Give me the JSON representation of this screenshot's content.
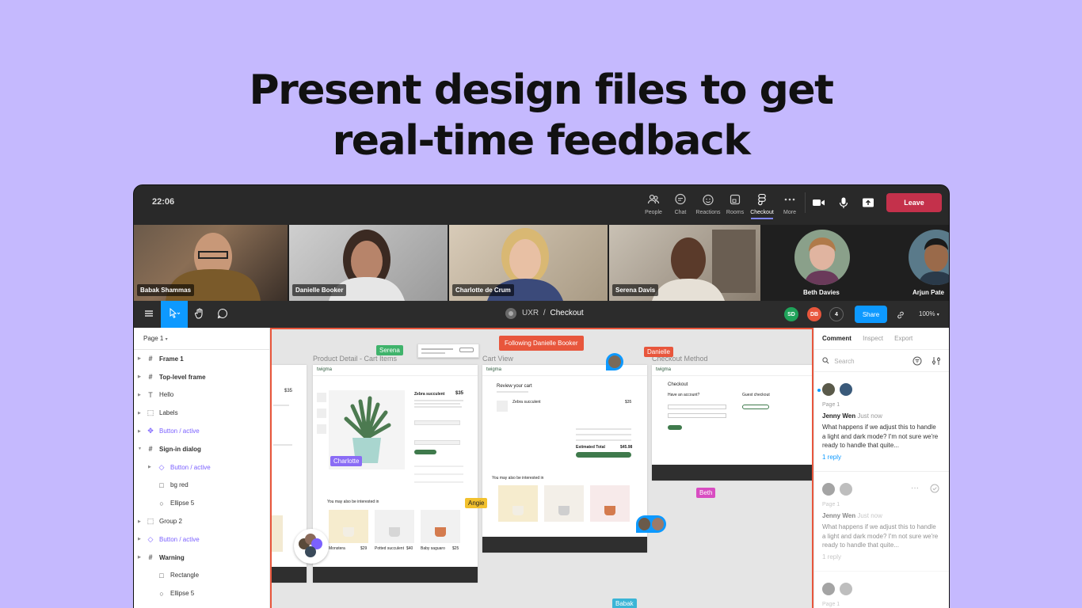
{
  "headline": {
    "line1": "Present design files to get",
    "line2": "real-time feedback"
  },
  "meeting": {
    "time": "22:06",
    "tools": [
      {
        "label": "People",
        "icon": "people-icon"
      },
      {
        "label": "Chat",
        "icon": "chat-icon"
      },
      {
        "label": "Reactions",
        "icon": "reactions-icon"
      },
      {
        "label": "Rooms",
        "icon": "rooms-icon"
      },
      {
        "label": "Checkout",
        "icon": "figma-icon"
      },
      {
        "label": "More",
        "icon": "more-icon"
      }
    ],
    "leave_label": "Leave",
    "participants": [
      "Babak Shammas",
      "Danielle Booker",
      "Charlotte de Crum",
      "Serena Davis"
    ],
    "avatars": [
      "Beth Davies",
      "Arjun Pate"
    ]
  },
  "figma": {
    "project": "UXR",
    "separator": "/",
    "file": "Checkout",
    "collaborators": [
      {
        "initials": "SD",
        "color": "#1fa35a"
      },
      {
        "initials": "DB",
        "color": "#e8563c"
      }
    ],
    "collab_count": "4",
    "share_label": "Share",
    "zoom": "100%"
  },
  "layers": {
    "page": "Page 1",
    "items": [
      {
        "label": "Frame 1",
        "icon": "frame-icon",
        "type": "bold"
      },
      {
        "label": "Top-level frame",
        "icon": "frame-icon",
        "type": "bold"
      },
      {
        "label": "Hello",
        "icon": "text-icon",
        "type": "plain"
      },
      {
        "label": "Labels",
        "icon": "group-icon",
        "type": "plain"
      },
      {
        "label": "Button / active",
        "icon": "component-icon",
        "type": "comp"
      },
      {
        "label": "Sign-in dialog",
        "icon": "frame-icon",
        "type": "bold"
      },
      {
        "label": "Button / active",
        "icon": "instance-icon",
        "type": "comp-sub"
      },
      {
        "label": "bg red",
        "icon": "rectangle-icon",
        "type": "sub"
      },
      {
        "label": "Ellipse 5",
        "icon": "ellipse-icon",
        "type": "sub"
      },
      {
        "label": "Group 2",
        "icon": "group-icon",
        "type": "plain"
      },
      {
        "label": "Button / active",
        "icon": "instance-icon",
        "type": "comp"
      },
      {
        "label": "Warning",
        "icon": "frame-icon",
        "type": "bold"
      },
      {
        "label": "Rectangle",
        "icon": "rectangle-icon",
        "type": "sub"
      },
      {
        "label": "Ellipse 5",
        "icon": "ellipse-icon",
        "type": "sub"
      }
    ]
  },
  "canvas": {
    "following": "Following Danielle Booker",
    "frames": [
      "Product Detail - Cart Items",
      "Cart View",
      "Checkout Method"
    ],
    "cursors": [
      {
        "name": "Serena",
        "color": "#3fb36b"
      },
      {
        "name": "Danielle",
        "color": "#e8563c"
      },
      {
        "name": "Charlotte",
        "color": "#8a6cf5"
      },
      {
        "name": "Angie",
        "color": "#f2c12e"
      },
      {
        "name": "Beth",
        "color": "#d84cc1"
      },
      {
        "name": "Babak",
        "color": "#3bb5d6"
      }
    ],
    "mock": {
      "brand": "twigma",
      "product_title": "Zebra succulent",
      "price": "$35",
      "review_title": "Review your cart",
      "checkout_title": "Checkout",
      "have_account": "Have an account?",
      "guest": "Guest checkout",
      "also_interested": "You may also be interested in",
      "estimated_total": "Estimated Total",
      "total_value": "$45.98",
      "items": [
        {
          "name": "Monstera",
          "price": "$29"
        },
        {
          "name": "Potted succulent",
          "price": "$40"
        },
        {
          "name": "Baby saguaro",
          "price": "$25"
        }
      ]
    }
  },
  "comments": {
    "tabs": [
      "Comment",
      "Inspect",
      "Export"
    ],
    "search_placeholder": "Search",
    "threads": [
      {
        "page": "Page 1",
        "author": "Jenny Wen",
        "time": "Just now",
        "body": "What happens if we adjust this to handle a light and dark mode? I'm not sure we're ready to handle that quite...",
        "replies": "1 reply"
      },
      {
        "page": "Page 1",
        "author": "Jenny Wen",
        "time": "Just now",
        "body": "What happens if we adjust this to handle a light and dark mode? I'm not sure we're ready to handle that quite...",
        "replies": "1 reply"
      },
      {
        "page": "Page 1"
      }
    ]
  }
}
